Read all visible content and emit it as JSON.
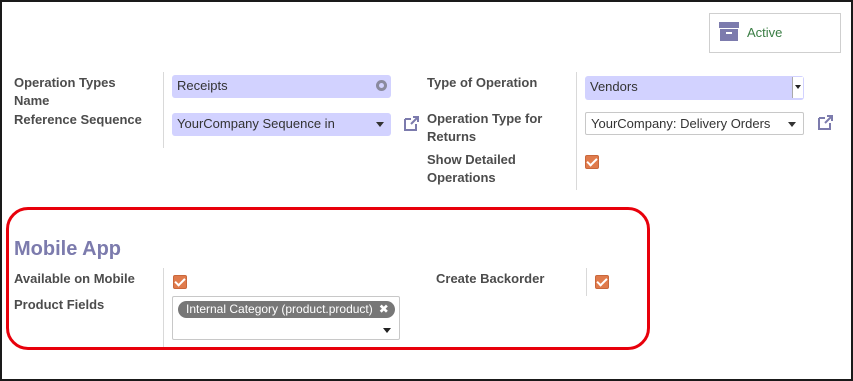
{
  "active_button": {
    "label": "Active",
    "icon": "archive-icon"
  },
  "form": {
    "operation_types_name": {
      "label": "Operation Types Name",
      "value": "Receipts"
    },
    "reference_sequence": {
      "label": "Reference Sequence",
      "value": "YourCompany Sequence in"
    },
    "type_of_operation": {
      "label": "Type of Operation",
      "value": "Vendors"
    },
    "return_type": {
      "label": "Operation Type for Returns",
      "value": "YourCompany: Delivery Orders"
    },
    "show_detailed": {
      "label": "Show Detailed Operations",
      "checked": true
    }
  },
  "mobile_app": {
    "title": "Mobile App",
    "available_on_mobile": {
      "label": "Available on Mobile",
      "checked": true
    },
    "create_backorder": {
      "label": "Create Backorder",
      "checked": true
    },
    "product_fields": {
      "label": "Product Fields",
      "tags": [
        "Internal Category (product.product)"
      ]
    }
  },
  "colors": {
    "accent": "#7c7bad",
    "required_bg": "#d2d2ff",
    "checkbox": "#e07b4c",
    "highlight": "#e8000b",
    "active_text": "#3a7d44"
  }
}
